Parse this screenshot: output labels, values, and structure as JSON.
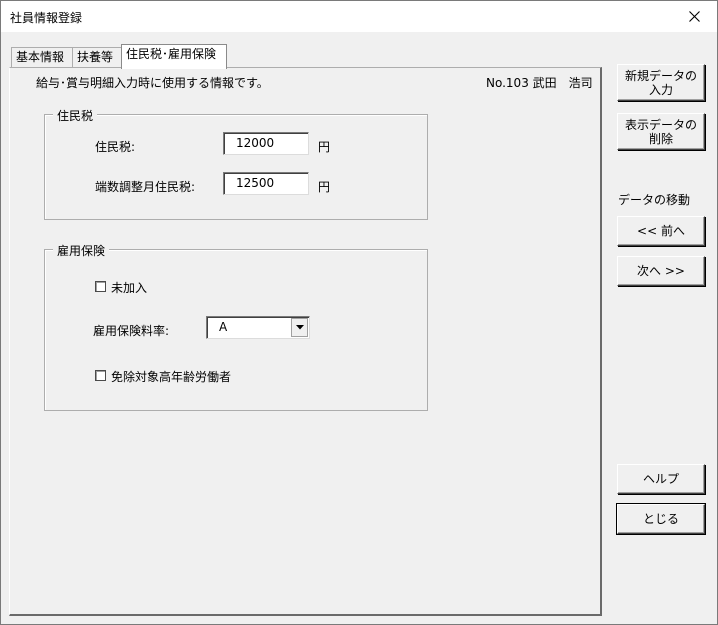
{
  "window": {
    "title": "社員情報登録"
  },
  "tabs": [
    {
      "label": "基本情報"
    },
    {
      "label": "扶養等"
    },
    {
      "label": "住民税･雇用保険"
    }
  ],
  "page": {
    "description": "給与･賞与明細入力時に使用する情報です。",
    "employee": "No.103 武田　浩司"
  },
  "resident_tax": {
    "group_title": "住民税",
    "tax_label": "住民税:",
    "tax_value": "12000",
    "tax_unit": "円",
    "adjust_label": "端数調整月住民税:",
    "adjust_value": "12500",
    "adjust_unit": "円"
  },
  "employment_insurance": {
    "group_title": "雇用保険",
    "not_enrolled_label": "未加入",
    "rate_label": "雇用保険料率:",
    "rate_value": "A",
    "exempt_label": "免除対象高年齢労働者"
  },
  "side": {
    "new_line1": "新規データの",
    "new_line2": "入力",
    "delete_line1": "表示データの",
    "delete_line2": "削除",
    "move_label": "データの移動",
    "prev": "<< 前へ",
    "next": "次へ >>",
    "help": "ヘルプ",
    "close": "とじる"
  }
}
